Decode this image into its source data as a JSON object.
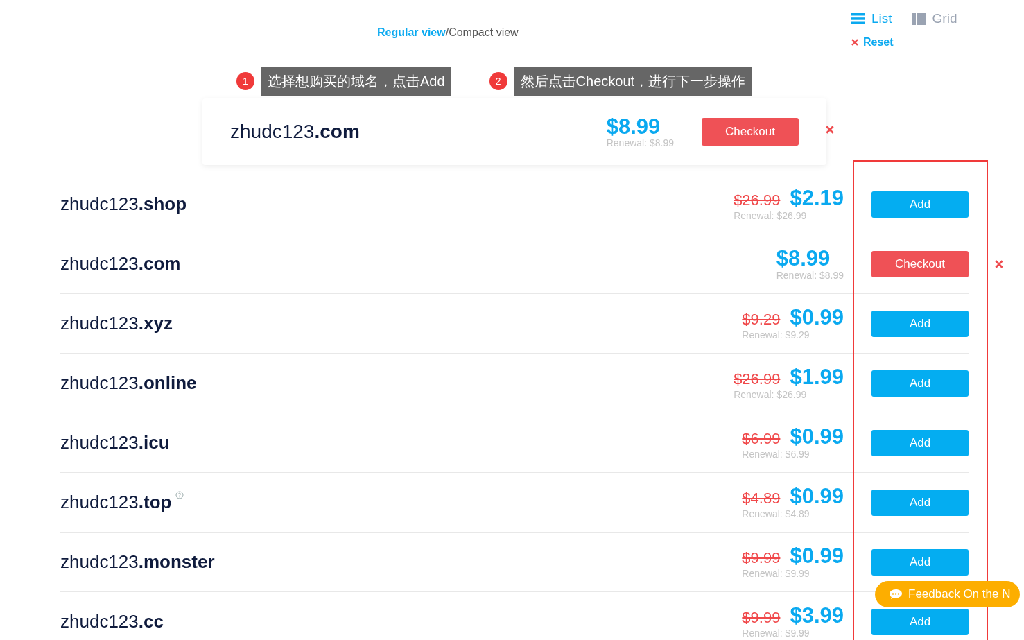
{
  "view_toggle": [
    {
      "label": "Regular view",
      "selected": true
    },
    {
      "label": "Compact view",
      "selected": false
    }
  ],
  "view_separator": "/",
  "layout_options": [
    {
      "label": "List",
      "kind": "list",
      "selected": true
    },
    {
      "label": "Grid",
      "kind": "grid",
      "selected": false
    }
  ],
  "reset": "Reset",
  "callouts": [
    {
      "number": "1",
      "text": "选择想购买的域名，点击Add"
    },
    {
      "number": "2",
      "text": "然后点击Checkout，进行下一步操作"
    }
  ],
  "cart_popup": {
    "domain": "zhudc123**.com**",
    "price": "$8.99",
    "renewal": "Renewal: $8.99",
    "button": "Checkout"
  },
  "results": [
    {
      "domain": "zhudc123**.shop**",
      "old_price": "$26.99",
      "price": "$2.19",
      "renewal": "Renewal: $26.99",
      "in_cart": false,
      "help": false,
      "button": "Add"
    },
    {
      "domain": "zhudc123**.com**",
      "price": "$8.99",
      "renewal": "Renewal: $8.99",
      "in_cart": true,
      "help": false,
      "button": "Checkout"
    },
    {
      "domain": "zhudc123**.xyz**",
      "old_price": "$9.29",
      "price": "$0.99",
      "renewal": "Renewal: $9.29",
      "in_cart": false,
      "help": false,
      "button": "Add"
    },
    {
      "domain": "zhudc123**.online**",
      "old_price": "$26.99",
      "price": "$1.99",
      "renewal": "Renewal: $26.99",
      "in_cart": false,
      "help": false,
      "button": "Add"
    },
    {
      "domain": "zhudc123**.icu**",
      "old_price": "$6.99",
      "price": "$0.99",
      "renewal": "Renewal: $6.99",
      "in_cart": false,
      "help": false,
      "button": "Add"
    },
    {
      "domain": "zhudc123**.top**",
      "old_price": "$4.89",
      "price": "$0.99",
      "renewal": "Renewal: $4.89",
      "in_cart": false,
      "help": true,
      "button": "Add"
    },
    {
      "domain": "zhudc123**.monster**",
      "old_price": "$9.99",
      "price": "$0.99",
      "renewal": "Renewal: $9.99",
      "in_cart": false,
      "help": false,
      "button": "Add"
    },
    {
      "domain": "zhudc123**.cc**",
      "old_price": "$9.99",
      "price": "$3.99",
      "renewal": "Renewal: $9.99",
      "in_cart": false,
      "help": false,
      "button": "Add"
    }
  ],
  "feedback_button": "Feedback On the N"
}
